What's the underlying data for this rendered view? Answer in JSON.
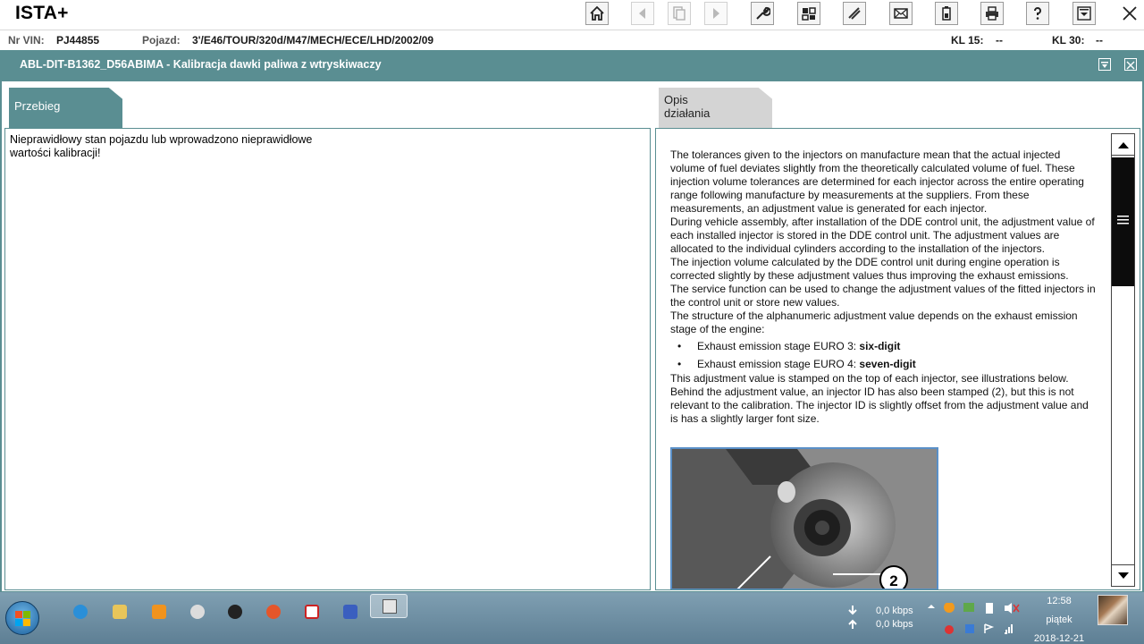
{
  "app": {
    "title": "ISTA+"
  },
  "toolbar": {
    "buttons": [
      {
        "name": "home-button",
        "icon": "home-icon"
      },
      {
        "name": "back-button",
        "icon": "chevron-left-icon"
      },
      {
        "name": "documents-button",
        "icon": "documents-icon"
      },
      {
        "name": "forward-button",
        "icon": "chevron-right-icon"
      },
      {
        "name": "service-button",
        "icon": "wrench-icon"
      },
      {
        "name": "measure-button",
        "icon": "measure-icon"
      },
      {
        "name": "diagnosis-button",
        "icon": "stethoscope-icon"
      },
      {
        "name": "mail-button",
        "icon": "envelope-icon"
      },
      {
        "name": "battery-button",
        "icon": "battery-icon"
      },
      {
        "name": "print-button",
        "icon": "printer-icon"
      },
      {
        "name": "help-button",
        "icon": "question-icon"
      },
      {
        "name": "minimize-button",
        "icon": "minimize-window-icon"
      },
      {
        "name": "close-button",
        "icon": "close-icon"
      }
    ]
  },
  "infobar": {
    "vin_label": "Nr VIN:",
    "vin_value": "PJ44855",
    "vehicle_label": "Pojazd:",
    "vehicle_value": "3'/E46/TOUR/320d/M47/MECH/ECE/LHD/2002/09",
    "kl15_label": "KL 15:",
    "kl15_value": "--",
    "kl30_label": "KL 30:",
    "kl30_value": "--"
  },
  "titlebar": {
    "title": "ABL-DIT-B1362_D56ABIMA  -  Kalibracja dawki paliwa z wtryskiwaczy"
  },
  "tabs": {
    "left": "Przebieg",
    "right": "Opis działania"
  },
  "left_panel": {
    "message_line1": "Nieprawidłowy stan pojazdu lub wprowadzono nieprawidłowe",
    "message_line2": "wartości kalibracji!"
  },
  "description": {
    "p1": "The tolerances given to the injectors on manufacture mean that the actual injected volume of fuel deviates slightly from the theoretically calculated volume of fuel. These injection volume tolerances are determined for each injector across the entire operating range following manufacture by measurements at the suppliers. From these measurements, an adjustment value is generated for each injector.",
    "p2": "During vehicle assembly, after installation of the DDE control unit, the adjustment value of each installed injector is stored in the DDE control unit. The adjustment values are allocated to the individual cylinders according to the installation of the injectors.",
    "p3": "The injection volume calculated by the DDE control unit during engine operation is corrected slightly by these adjustment values thus improving the exhaust emissions.",
    "p4": "The service function can be used to change the adjustment values of the fitted injectors in the control unit or store new values.",
    "p5": "The structure of the alphanumeric adjustment value depends on the exhaust emission stage of the engine:",
    "bullets": [
      {
        "text": "Exhaust emission stage EURO 3: ",
        "bold": "six-digit"
      },
      {
        "text": "Exhaust emission stage EURO 4: ",
        "bold": "seven-digit"
      }
    ],
    "p6": "This adjustment value is stamped on the top of each injector, see illustrations below. Behind the adjustment value, an injector ID has also been stamped (2), but this is not relevant to the calibration. The injector ID is slightly offset from the adjustment value and is has a slightly larger font size.",
    "image_callout": "2"
  },
  "taskbar": {
    "net_down": "0,0 kbps",
    "net_up": "0,0 kbps",
    "time": "12:58",
    "day": "piątek",
    "date": "2018-12-21"
  },
  "colors": {
    "accent": "#5a8e92",
    "tab_inactive": "#d4d4d4",
    "taskbar": "#6b8ba0"
  }
}
